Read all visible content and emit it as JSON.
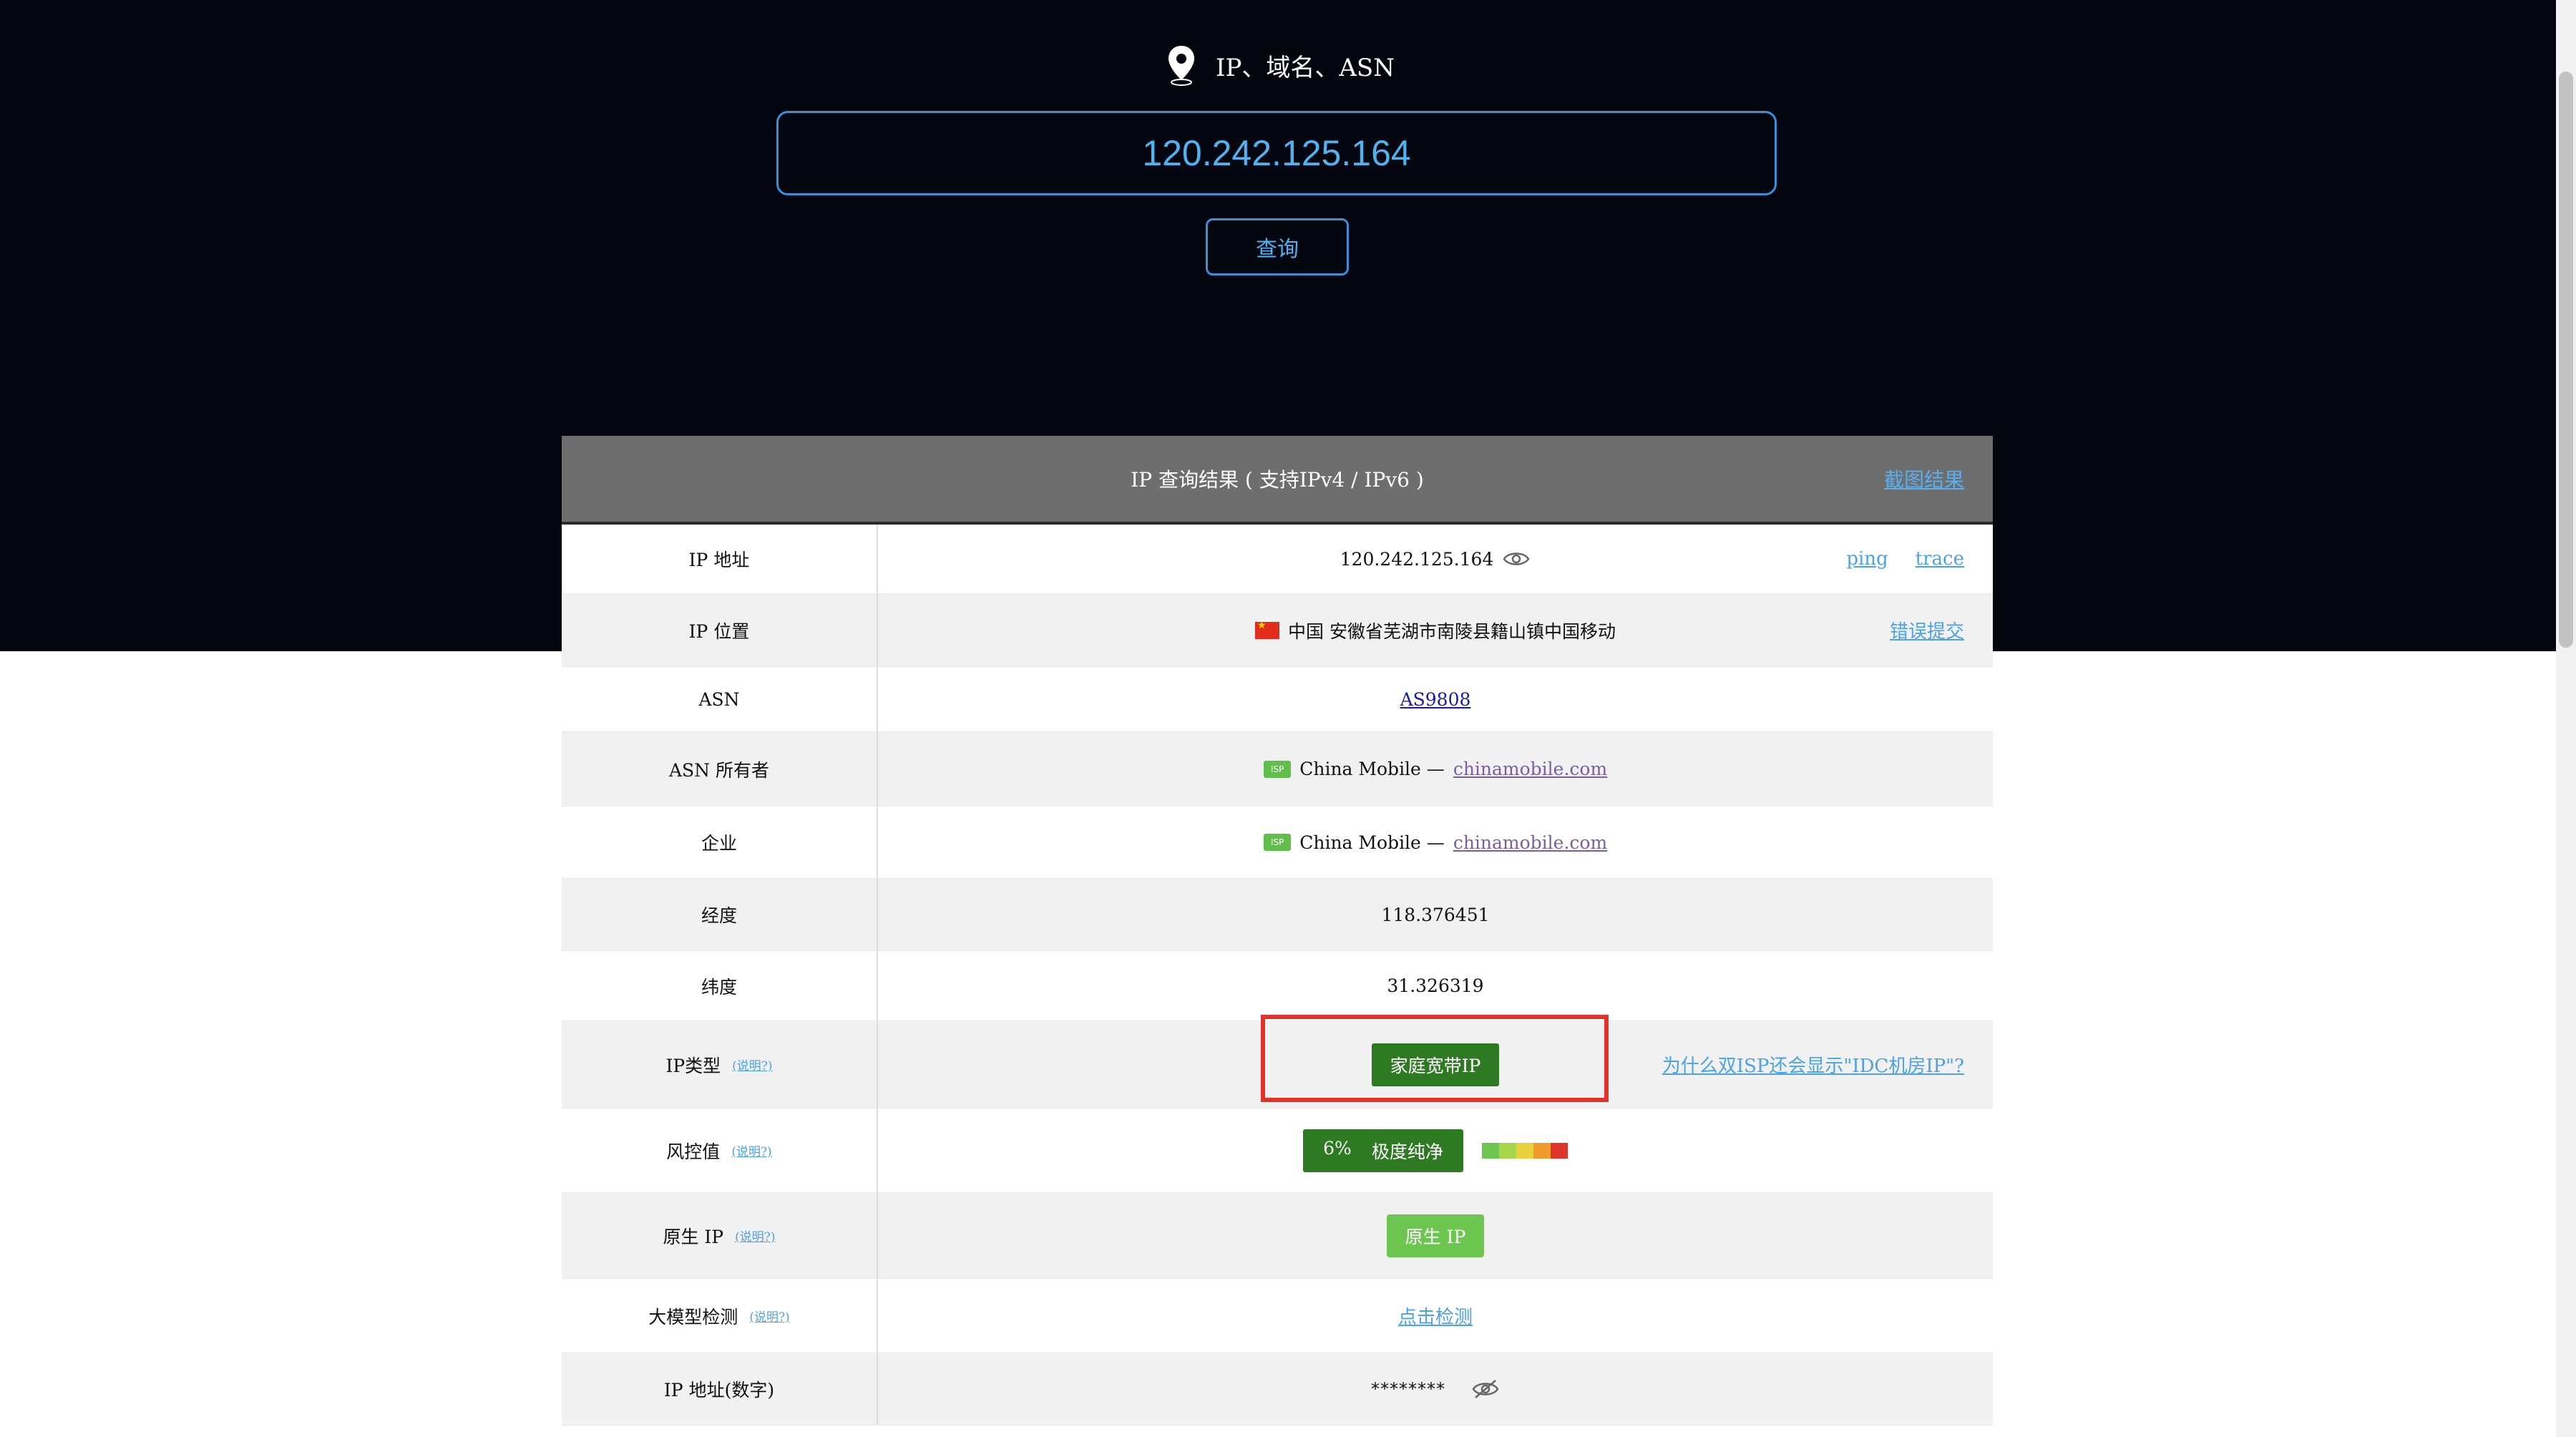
{
  "search": {
    "label": "IP、域名、ASN",
    "value": "120.242.125.164",
    "query_button": "查询"
  },
  "result": {
    "header_title": "IP 查询结果 ( 支持IPv4 / IPv6 )",
    "screenshot_link": "截图结果",
    "rows": {
      "ip_address": {
        "label": "IP 地址",
        "value": "120.242.125.164",
        "ping": "ping",
        "trace": "trace"
      },
      "ip_location": {
        "label": "IP 位置",
        "value": "中国 安徽省芜湖市南陵县籍山镇中国移动",
        "report_link": "错误提交"
      },
      "asn": {
        "label": "ASN",
        "value": "AS9808"
      },
      "asn_owner": {
        "label": "ASN 所有者",
        "badge": "ISP",
        "name": "China Mobile —",
        "domain": "chinamobile.com"
      },
      "enterprise": {
        "label": "企业",
        "badge": "ISP",
        "name": "China Mobile —",
        "domain": "chinamobile.com"
      },
      "longitude": {
        "label": "经度",
        "value": "118.376451"
      },
      "latitude": {
        "label": "纬度",
        "value": "31.326319"
      },
      "ip_type": {
        "label": "IP类型",
        "help": "(说明?)",
        "badge": "家庭宽带IP",
        "side_link": "为什么双ISP还会显示\"IDC机房IP\"?"
      },
      "risk": {
        "label": "风控值",
        "help": "(说明?)",
        "score": "6%",
        "level": "极度纯净",
        "scale_colors": [
          "#6cc64f",
          "#a8d64a",
          "#e8d13a",
          "#f29a2e",
          "#e0332a"
        ]
      },
      "native_ip": {
        "label": "原生 IP",
        "help": "(说明?)",
        "badge": "原生 IP"
      },
      "llm_check": {
        "label": "大模型检测",
        "help": "(说明?)",
        "link": "点击检测"
      },
      "ip_numeric": {
        "label": "IP 地址(数字)",
        "value": "********"
      }
    }
  },
  "colors": {
    "hero_bg": "#03060f",
    "accent_blue": "#3b8fd8",
    "badge_green": "#2e7a22",
    "native_green": "#6cc64f",
    "highlight_red": "#e0332a",
    "header_gray": "#6e6e6e"
  },
  "icons": {
    "location": "map-pin-icon",
    "show": "eye-icon",
    "hide": "eye-off-icon",
    "flag": "china-flag-icon"
  }
}
